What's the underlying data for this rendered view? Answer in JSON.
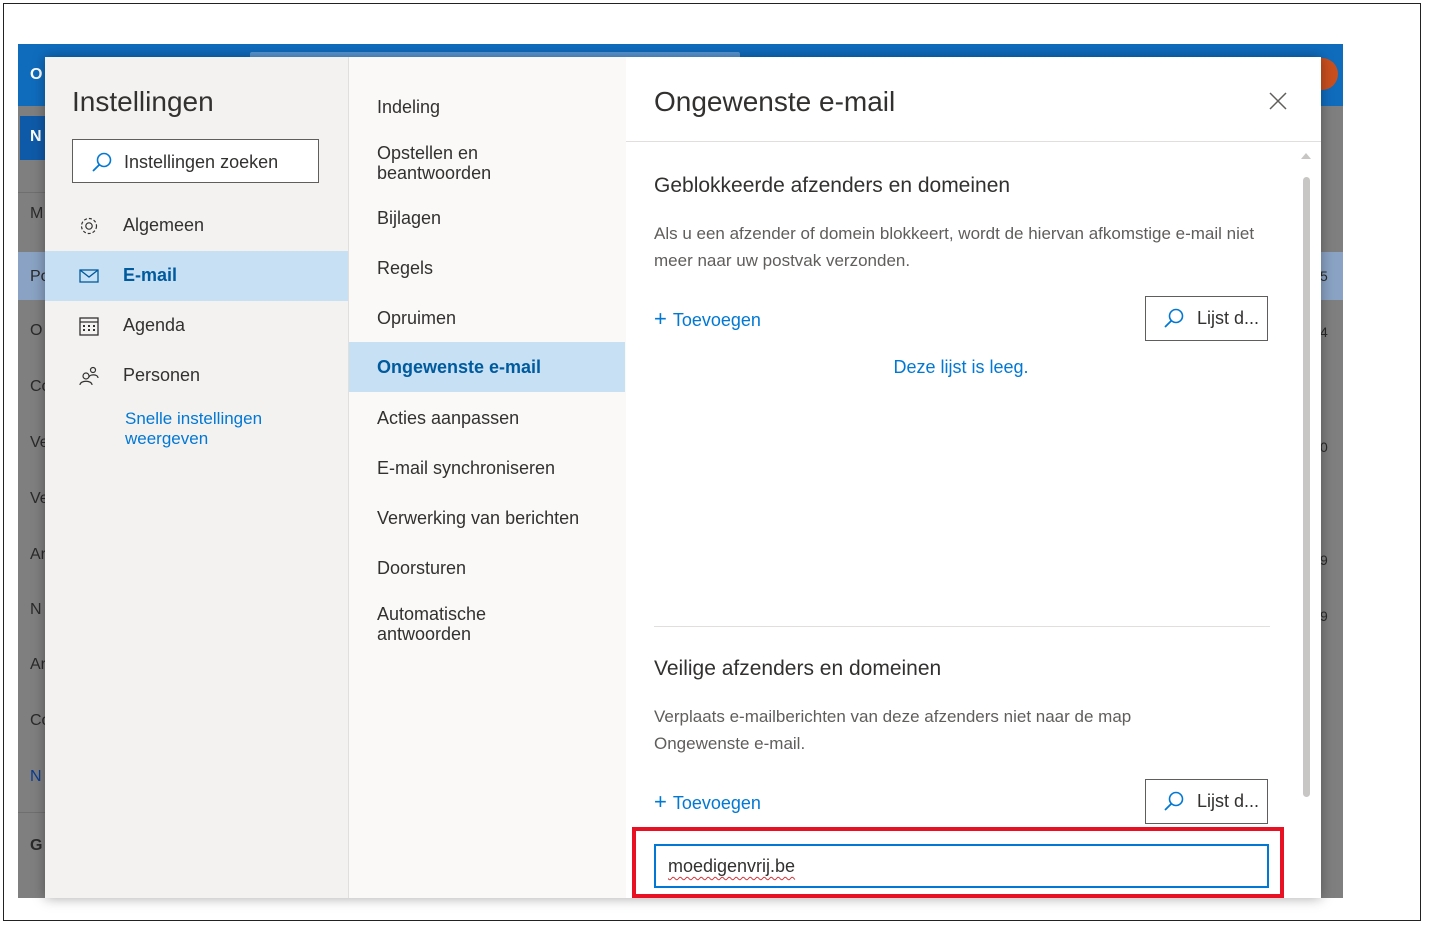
{
  "background": {
    "app_letter": "O",
    "new_letter": "N",
    "rows": [
      "M",
      "Po",
      "O",
      "Co",
      "Ve",
      "Ve",
      "Ar",
      "N",
      "Ar",
      "Co",
      "N",
      "G"
    ],
    "nums": [
      "5",
      "4",
      "0",
      "9",
      "9"
    ]
  },
  "settings": {
    "title": "Instellingen",
    "search_placeholder": "Instellingen zoeken",
    "categories": [
      {
        "label": "Algemeen",
        "icon": "gear-icon"
      },
      {
        "label": "E-mail",
        "icon": "mail-icon"
      },
      {
        "label": "Agenda",
        "icon": "calendar-icon"
      },
      {
        "label": "Personen",
        "icon": "people-icon"
      }
    ],
    "quick_settings_link": "Snelle instellingen weergeven"
  },
  "mail_menu": {
    "items": [
      "Indeling",
      "Opstellen en beantwoorden",
      "Bijlagen",
      "Regels",
      "Opruimen",
      "Ongewenste e-mail",
      "Acties aanpassen",
      "E-mail synchroniseren",
      "Verwerking van berichten",
      "Doorsturen",
      "Automatische antwoorden"
    ],
    "selected": "Ongewenste e-mail"
  },
  "junk_pane": {
    "title": "Ongewenste e-mail",
    "blocked": {
      "title": "Geblokkeerde afzenders en domeinen",
      "description": "Als u een afzender of domein blokkeert, wordt de hiervan afkomstige e-mail niet meer naar uw postvak verzonden.",
      "add_label": "Toevoegen",
      "search_label": "Lijst d...",
      "empty_text": "Deze lijst is leeg."
    },
    "safe": {
      "title": "Veilige afzenders en domeinen",
      "description": "Verplaats e-mailberichten van deze afzenders niet naar de map Ongewenste e-mail.",
      "add_label": "Toevoegen",
      "search_label": "Lijst d...",
      "input_value": "moedigenvrij.be"
    }
  },
  "colors": {
    "accent": "#0078d4",
    "selected_bg": "#c7e0f4",
    "highlight": "#e81123",
    "header": "#0f6cbd"
  }
}
